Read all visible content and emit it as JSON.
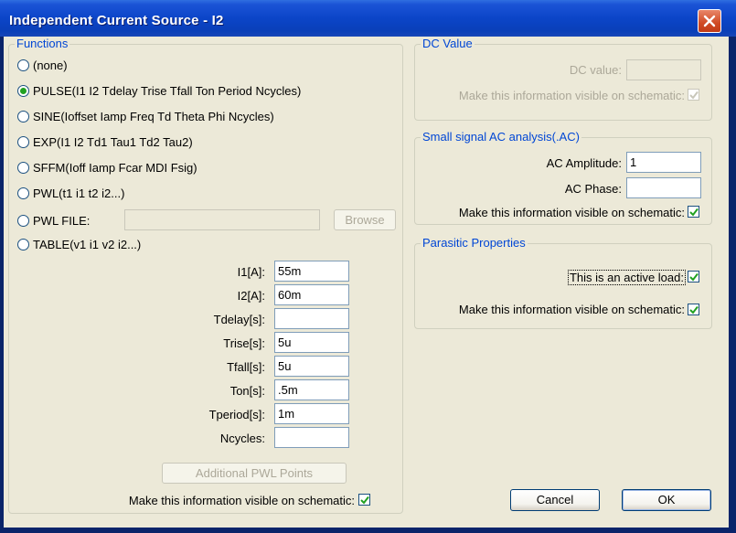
{
  "window": {
    "title": "Independent Current Source - I2"
  },
  "functions": {
    "title": "Functions",
    "options": [
      {
        "label": "(none)",
        "checked": false
      },
      {
        "label": "PULSE(I1 I2 Tdelay Trise Tfall Ton Period Ncycles)",
        "checked": true
      },
      {
        "label": "SINE(Ioffset Iamp Freq Td Theta Phi Ncycles)",
        "checked": false
      },
      {
        "label": "EXP(I1 I2 Td1 Tau1 Td2 Tau2)",
        "checked": false
      },
      {
        "label": "SFFM(Ioff Iamp Fcar MDI Fsig)",
        "checked": false
      },
      {
        "label": "PWL(t1 i1 t2 i2...)",
        "checked": false
      },
      {
        "label": "PWL FILE:",
        "checked": false
      },
      {
        "label": "TABLE(v1 i1 v2 i2...)",
        "checked": false
      }
    ],
    "pwl_file_value": "",
    "browse_label": "Browse",
    "params": [
      {
        "label": "I1[A]:",
        "value": "55m"
      },
      {
        "label": "I2[A]:",
        "value": "60m"
      },
      {
        "label": "Tdelay[s]:",
        "value": ""
      },
      {
        "label": "Trise[s]:",
        "value": "5u"
      },
      {
        "label": "Tfall[s]:",
        "value": "5u"
      },
      {
        "label": "Ton[s]:",
        "value": ".5m"
      },
      {
        "label": "Tperiod[s]:",
        "value": "1m"
      },
      {
        "label": "Ncycles:",
        "value": ""
      }
    ],
    "additional_pwl_label": "Additional PWL Points",
    "visible_label": "Make this information visible on schematic:",
    "visible_checked": true
  },
  "dc": {
    "title": "DC Value",
    "value_label": "DC value:",
    "value": "",
    "visible_label": "Make this information visible on schematic:",
    "visible_checked": true
  },
  "ac": {
    "title": "Small signal AC analysis(.AC)",
    "amp_label": "AC Amplitude:",
    "amp_value": "1",
    "phase_label": "AC Phase:",
    "phase_value": "",
    "visible_label": "Make this information visible on schematic:",
    "visible_checked": true
  },
  "parasitic": {
    "title": "Parasitic Properties",
    "active_label": "This is an active load:",
    "active_checked": true,
    "visible_label": "Make this information visible on schematic:",
    "visible_checked": true
  },
  "buttons": {
    "cancel": "Cancel",
    "ok": "OK"
  },
  "colors": {
    "group_title": "#0046d5",
    "check": "#21a121",
    "face": "#ece9d8"
  }
}
